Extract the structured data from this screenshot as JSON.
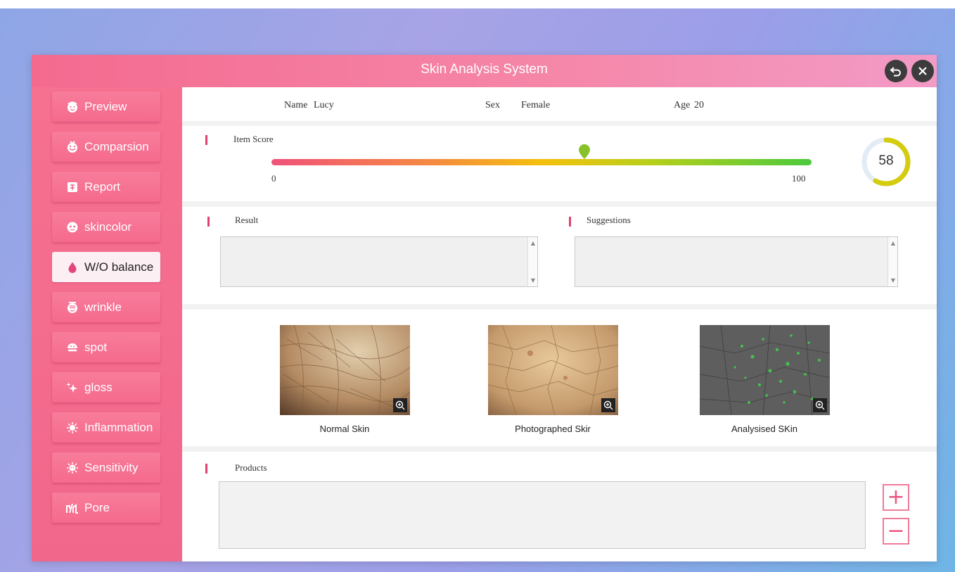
{
  "window": {
    "title": "Skin Analysis System"
  },
  "sidebar": {
    "items": [
      {
        "label": "Preview",
        "icon": "face-icon"
      },
      {
        "label": "Comparsion",
        "icon": "compare-face-icon"
      },
      {
        "label": "Report",
        "icon": "report-icon"
      },
      {
        "label": "skincolor",
        "icon": "skincolor-icon"
      },
      {
        "label": "W/O balance",
        "icon": "water-drop-icon"
      },
      {
        "label": "wrinkle",
        "icon": "wrinkle-icon"
      },
      {
        "label": "spot",
        "icon": "spot-icon"
      },
      {
        "label": "gloss",
        "icon": "sparkle-icon"
      },
      {
        "label": "Inflammation",
        "icon": "inflammation-icon"
      },
      {
        "label": "Sensitivity",
        "icon": "sensitivity-icon"
      },
      {
        "label": "Pore",
        "icon": "pore-icon"
      }
    ],
    "active_index": 4
  },
  "patient": {
    "name_label": "Name",
    "name": "Lucy",
    "sex_label": "Sex",
    "sex": "Female",
    "age_label": "Age",
    "age": "20"
  },
  "score": {
    "label": "Item Score",
    "min": "0",
    "max": "100",
    "value": "58",
    "value_num": 58,
    "colors": {
      "low": "#f0527a",
      "mid": "#f5c00e",
      "high": "#4cc93e",
      "ring": "#d4cc0e"
    }
  },
  "result": {
    "label": "Result"
  },
  "suggestions": {
    "label": "Suggestions"
  },
  "images": [
    {
      "caption": "Normal Skin"
    },
    {
      "caption": "Photographed Skir"
    },
    {
      "caption": "Analysised SKin"
    }
  ],
  "products": {
    "label": "Products",
    "add": "+",
    "remove": "−"
  },
  "accent": "#f26a8e"
}
